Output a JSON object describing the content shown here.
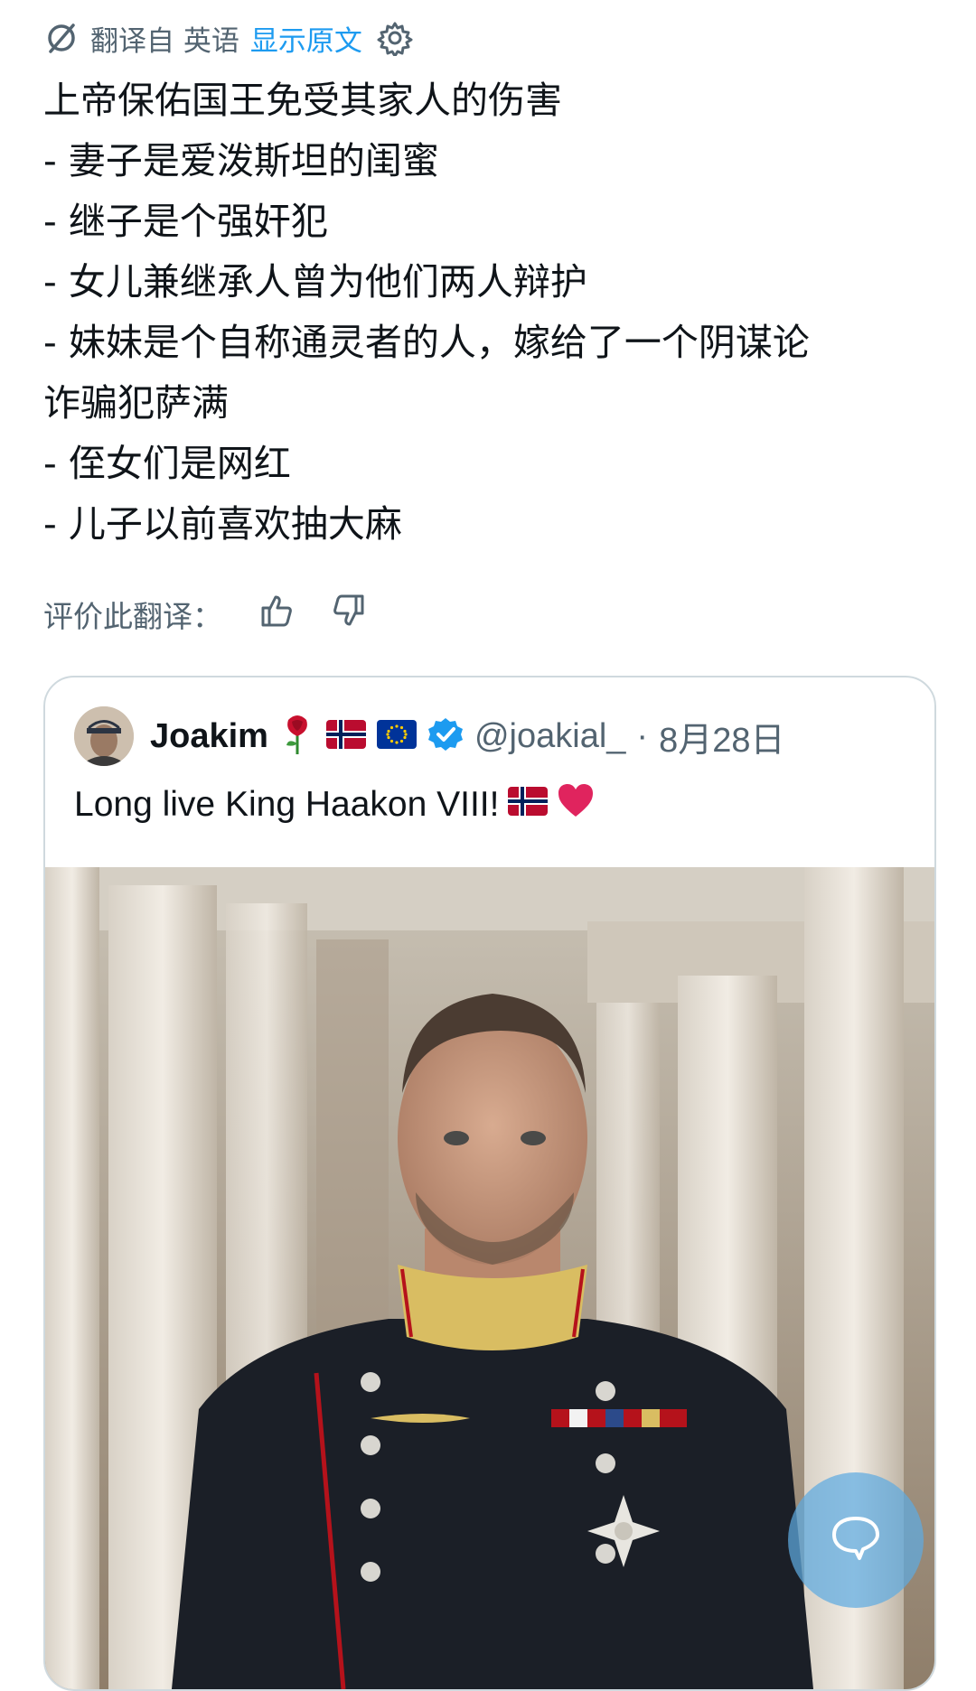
{
  "translation_bar": {
    "translated_from": "翻译自 英语",
    "show_original": "显示原文"
  },
  "translated_text": {
    "lines": [
      "上帝保佑国王免受其家人的伤害",
      "- 妻子是爱泼斯坦的闺蜜",
      "- 继子是个强奸犯",
      "- 女儿兼继承人曾为他们两人辩护",
      "- 妹妹是个自称通灵者的人，嫁给了一个阴谋论",
      "诈骗犯萨满",
      "- 侄女们是网红",
      "- 儿子以前喜欢抽大麻"
    ]
  },
  "rating": {
    "label": "评价此翻译："
  },
  "quoted_post": {
    "display_name": "Joakim",
    "handle": "@joakial_",
    "separator": "·",
    "date": "8月28日",
    "text": "Long live King Haakon VIII!",
    "badges": [
      "rose",
      "norway-flag",
      "eu-flag",
      "verified"
    ]
  },
  "colors": {
    "accent": "#1d9bf0",
    "text": "#0f1419",
    "secondary_text": "#536471",
    "border": "#cfd9de",
    "heart": "#e0245e"
  }
}
